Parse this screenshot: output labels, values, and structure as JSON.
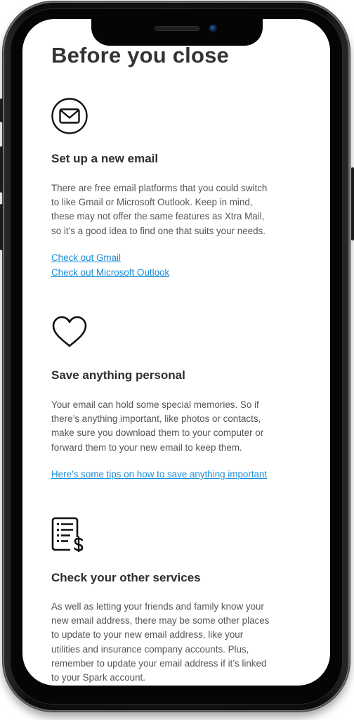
{
  "page_title": "Before you close",
  "sections": [
    {
      "icon": "envelope-icon",
      "heading": "Set up a new email",
      "body_lines": [
        "There are free email platforms that you could switch",
        "to like Gmail or Microsoft Outlook. Keep in mind,",
        "these may not offer the same features as Xtra Mail,",
        "so it’s a good idea to find one that suits your needs."
      ],
      "links": [
        "Check out Gmail",
        "Check out Microsoft Outlook"
      ]
    },
    {
      "icon": "heart-icon",
      "heading": "Save anything personal",
      "body_lines": [
        "Your email can hold some special memories. So if",
        "there’s anything important, like photos or contacts,",
        "make sure you download them to your computer or",
        "forward them to your new email to keep them."
      ],
      "links": [
        "Here’s some tips on how to save anything important"
      ]
    },
    {
      "icon": "bill-list-icon",
      "heading": "Check your other services",
      "body_lines": [
        "As well as letting your friends and family know your",
        "new email address, there may be some other places",
        "to update to your new email address, like your",
        "utilities and insurance company accounts. Plus,",
        "remember to update your email address if it’s linked",
        "to your Spark account."
      ],
      "links": []
    }
  ],
  "colors": {
    "link": "#1a8cd8",
    "heading": "#2e2e2e",
    "body": "#555555"
  }
}
